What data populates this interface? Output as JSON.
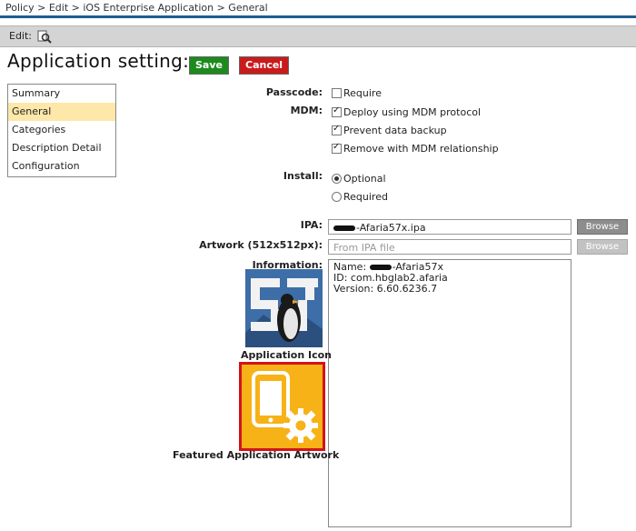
{
  "breadcrumb": "Policy > Edit > iOS Enterprise Application > General",
  "edit_bar": {
    "label": "Edit:",
    "icon": "magnifier-edit-icon"
  },
  "page": {
    "title": "Application setting:"
  },
  "buttons": {
    "save": "Save",
    "cancel": "Cancel"
  },
  "colors": {
    "save": "#1d8a1d",
    "cancel": "#c91b1b",
    "active_nav": "#fde7a9",
    "highlight_border": "#d4121b",
    "artwork_bg": "#f7b217"
  },
  "nav": {
    "items": [
      {
        "label": "Summary",
        "active": false
      },
      {
        "label": "General",
        "active": true
      },
      {
        "label": "Categories",
        "active": false
      },
      {
        "label": "Description Detail",
        "active": false
      },
      {
        "label": "Configuration",
        "active": false
      }
    ]
  },
  "form": {
    "passcode": {
      "label": "Passcode:",
      "option": "Require",
      "checked": false
    },
    "mdm": {
      "label": "MDM:",
      "options": [
        {
          "label": "Deploy using MDM protocol",
          "checked": true
        },
        {
          "label": "Prevent data backup",
          "checked": true
        },
        {
          "label": "Remove with MDM relationship",
          "checked": true
        }
      ]
    },
    "install": {
      "label": "Install:",
      "options": [
        {
          "label": "Optional",
          "selected": true
        },
        {
          "label": "Required",
          "selected": false
        }
      ]
    },
    "ipa": {
      "label": "IPA:",
      "value": "-Afaria57x.ipa",
      "browse": "Browse"
    },
    "artwork": {
      "label": "Artwork (512x512px):",
      "placeholder": "From IPA file",
      "browse": "Browse"
    },
    "information": {
      "label": "Information:",
      "name_prefix": "Name:",
      "name_value": "-Afaria57x",
      "id": "ID: com.hbglab2.afaria",
      "version": "Version: 6.60.6236.7"
    },
    "app_icon_caption": "Application Icon",
    "featured_caption": "Featured Application Artwork"
  }
}
